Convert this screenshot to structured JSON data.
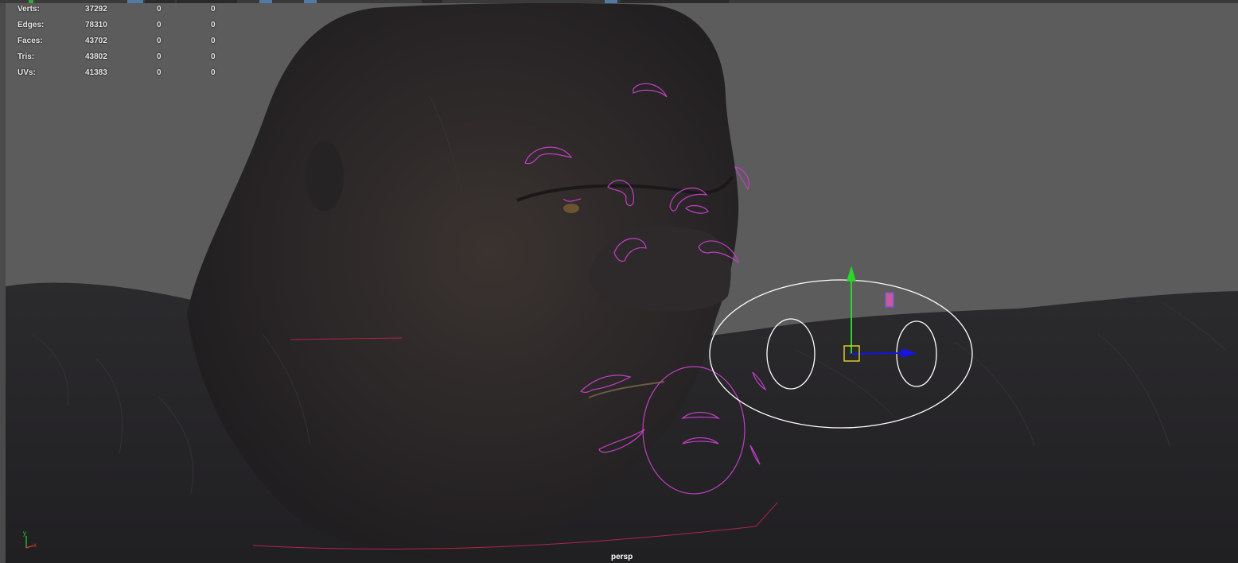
{
  "viewport": {
    "camera_label": "persp",
    "background_color": "#5c5c5c"
  },
  "hud": {
    "rows": [
      {
        "label": "Verts:",
        "total": "37292",
        "selected": "0",
        "third": "0"
      },
      {
        "label": "Edges:",
        "total": "78310",
        "selected": "0",
        "third": "0"
      },
      {
        "label": "Faces:",
        "total": "43702",
        "selected": "0",
        "third": "0"
      },
      {
        "label": "Tris:",
        "total": "43802",
        "selected": "0",
        "third": "0"
      },
      {
        "label": "UVs:",
        "total": "41383",
        "selected": "0",
        "third": "0"
      }
    ]
  },
  "axis": {
    "y": "y",
    "x": "x"
  },
  "colors": {
    "control_curve": "#c03fc3",
    "selected_control": "#ffffff",
    "move_y": "#2ad62a",
    "move_x": "#1414e6",
    "pivot": "#e6d52a",
    "guide_line": "#b0244a"
  },
  "icons": {
    "move_manipulator": "move-manipulator-icon",
    "pivot": "pivot-square-icon",
    "axis": "axis-gizmo-icon"
  }
}
